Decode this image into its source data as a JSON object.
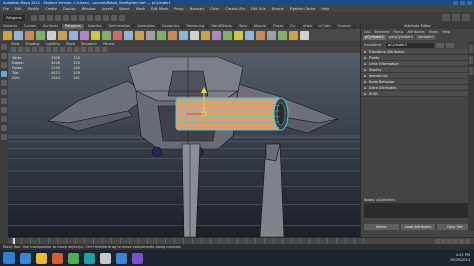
{
  "window": {
    "title": "Autodesk Maya 2014 - Student Version: C:\\Users\\...\\scenes\\Robot_Starfighter.mb* --- pCylinder1"
  },
  "menubar": {
    "items": [
      "File",
      "Edit",
      "Modify",
      "Create",
      "Display",
      "Window",
      "Assets",
      "Select",
      "Mesh",
      "Edit Mesh",
      "Proxy",
      "Normals",
      "Color",
      "Create UVs",
      "Edit UVs",
      "Muscle",
      "Pipeline Cache",
      "Help"
    ]
  },
  "statusline": {
    "mode": "Polygons"
  },
  "shelf": {
    "tabs": [
      "General",
      "Curves",
      "Surfaces",
      "Polygons",
      "Subdivs",
      "Deformation",
      "Animation",
      "Dynamics",
      "Rendering",
      "PaintEffects",
      "Toon",
      "Muscle",
      "Fluids",
      "Fur",
      "nHair",
      "nCloth",
      "Custom"
    ],
    "active_tab": "Polygons",
    "icon_colors": [
      "#c9a24a",
      "#8fb3d9",
      "#c98a5a",
      "#7fb069",
      "#d0d0d0",
      "#c9a24a",
      "#8fb3d9",
      "#b084c9",
      "#c9c94a",
      "#7fb069",
      "#d06a6a",
      "#8fb3d9",
      "#c9a24a",
      "#a0a0a0",
      "#7fb069",
      "#c98a5a",
      "#8fb3d9",
      "#d0d0d0",
      "#c9a24a",
      "#b084c9",
      "#7fb069",
      "#c9c94a",
      "#8fb3d9",
      "#c98a5a",
      "#a0a0a0",
      "#7fb069",
      "#c9a24a",
      "#d0d0d0"
    ]
  },
  "viewport": {
    "panel_menu": [
      "View",
      "Shading",
      "Lighting",
      "Show",
      "Renderer",
      "Panels"
    ],
    "hud": {
      "rows": [
        {
          "label": "Verts:",
          "v1": "2306",
          "v2": "120"
        },
        {
          "label": "Edges:",
          "v1": "4526",
          "v2": "220"
        },
        {
          "label": "Faces:",
          "v1": "2240",
          "v2": "100"
        },
        {
          "label": "Tris:",
          "v1": "4412",
          "v2": "200"
        },
        {
          "label": "UVs:",
          "v1": "2554",
          "v2": "141"
        }
      ]
    },
    "colors": {
      "hull": "#7c7f86",
      "hull_dark": "#4f525a",
      "wireframe": "#141414",
      "selection": "#47c7e0",
      "cylinder_face": "#d9a273",
      "cylinder_top": "#e3b68a",
      "manipulator_y": "#e0e040",
      "manipulator_x": "#e04040",
      "landing_gear": "#25255a",
      "grid": "#6b7480"
    }
  },
  "attribute_editor": {
    "title": "Attribute Editor",
    "menu": [
      "List",
      "Selected",
      "Focus",
      "Attributes",
      "Show",
      "Help"
    ],
    "tabs": [
      "pCylinder1",
      "polyCylinder1",
      "lambert1"
    ],
    "active_tab": "pCylinder1",
    "node_label": "transform:",
    "node_value": "pCylinder1",
    "sections": [
      "Transform Attributes",
      "Pivots",
      "Limit Information",
      "Display",
      "mental ray",
      "Node Behavior",
      "Extra Attributes",
      "UUID"
    ],
    "notes_label": "Notes: pCylinder1",
    "buttons": [
      "Select",
      "Load Attributes",
      "Copy Tab"
    ]
  },
  "timeslider": {
    "start": "1",
    "end": "24"
  },
  "helpline": {
    "text": "Move Tool: Use manipulator to move object(s). Ctrl+middle-drag to move components along normals."
  },
  "taskbar": {
    "time": "4:22 PM",
    "date": "20/09/2014",
    "app_colors": [
      "#3a86d6",
      "#f1b82d",
      "#e05a2b",
      "#4caf50",
      "#12a6a6",
      "#c9c9c9",
      "#3a86d6",
      "#7a4fd0"
    ]
  }
}
